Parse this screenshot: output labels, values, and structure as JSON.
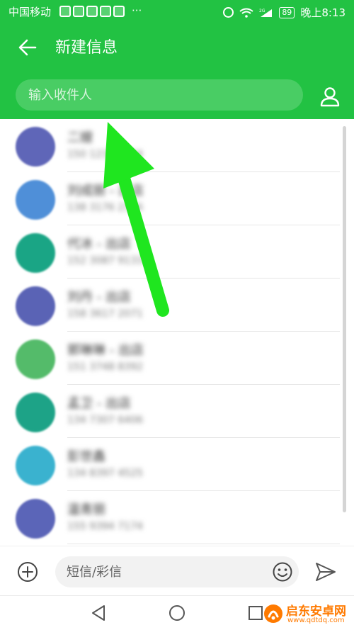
{
  "status_bar": {
    "carrier": "中国移动",
    "more": "···",
    "network": "2G",
    "battery": "89",
    "time": "晚上8:13"
  },
  "header": {
    "title": "新建信息",
    "recipient_placeholder": "输入收件人"
  },
  "contacts": [
    {
      "name": "二嫂",
      "number": "150 1234 5684",
      "color": "#5f66b8"
    },
    {
      "name": "刘成丽 - 出店",
      "number": "138 3176 2346",
      "color": "#4f8fd8"
    },
    {
      "name": "代冰 - 出店",
      "number": "152 3087 9133",
      "color": "#1aa585"
    },
    {
      "name": "刘丹 - 出店",
      "number": "158 3617 2071",
      "color": "#5a63b5"
    },
    {
      "name": "郭琳琳 - 出店",
      "number": "151 3748 8392",
      "color": "#54bb6a"
    },
    {
      "name": "孟卫 - 出店",
      "number": "134 7307 6406",
      "color": "#1da387"
    },
    {
      "name": "彭世鑫",
      "number": "134 8397 4525",
      "color": "#3ab2cf"
    },
    {
      "name": "温青丽",
      "number": "155 9394 7174",
      "color": "#5b65b8"
    }
  ],
  "compose": {
    "placeholder": "短信/彩信"
  },
  "watermark": {
    "name": "启东安卓网",
    "url": "www.qdtdq.com"
  },
  "colors": {
    "accent": "#22c243",
    "arrow": "#1fe61f"
  },
  "icons": [
    "back-arrow-icon",
    "contact-picker-icon",
    "add-icon",
    "emoji-icon",
    "send-icon",
    "nav-back-icon",
    "nav-home-icon",
    "nav-recent-icon"
  ]
}
